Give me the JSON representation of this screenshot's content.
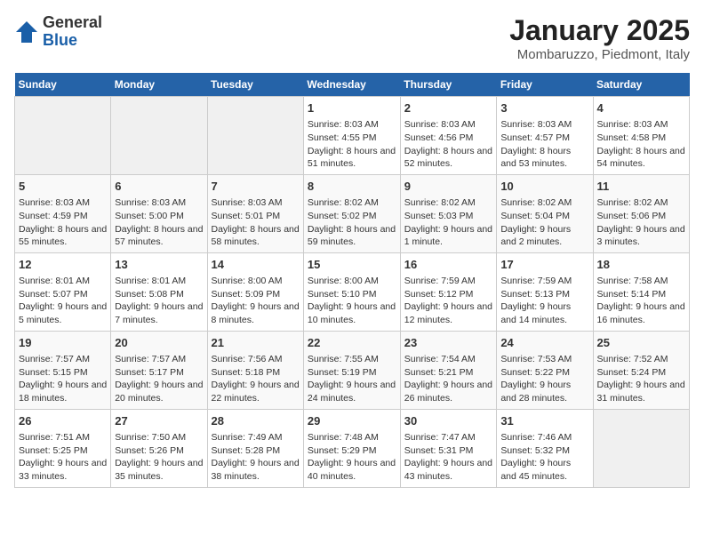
{
  "logo": {
    "general": "General",
    "blue": "Blue"
  },
  "title": "January 2025",
  "subtitle": "Mombaruzzo, Piedmont, Italy",
  "days_of_week": [
    "Sunday",
    "Monday",
    "Tuesday",
    "Wednesday",
    "Thursday",
    "Friday",
    "Saturday"
  ],
  "weeks": [
    [
      {
        "day": "",
        "info": ""
      },
      {
        "day": "",
        "info": ""
      },
      {
        "day": "",
        "info": ""
      },
      {
        "day": "1",
        "info": "Sunrise: 8:03 AM\nSunset: 4:55 PM\nDaylight: 8 hours and 51 minutes."
      },
      {
        "day": "2",
        "info": "Sunrise: 8:03 AM\nSunset: 4:56 PM\nDaylight: 8 hours and 52 minutes."
      },
      {
        "day": "3",
        "info": "Sunrise: 8:03 AM\nSunset: 4:57 PM\nDaylight: 8 hours and 53 minutes."
      },
      {
        "day": "4",
        "info": "Sunrise: 8:03 AM\nSunset: 4:58 PM\nDaylight: 8 hours and 54 minutes."
      }
    ],
    [
      {
        "day": "5",
        "info": "Sunrise: 8:03 AM\nSunset: 4:59 PM\nDaylight: 8 hours and 55 minutes."
      },
      {
        "day": "6",
        "info": "Sunrise: 8:03 AM\nSunset: 5:00 PM\nDaylight: 8 hours and 57 minutes."
      },
      {
        "day": "7",
        "info": "Sunrise: 8:03 AM\nSunset: 5:01 PM\nDaylight: 8 hours and 58 minutes."
      },
      {
        "day": "8",
        "info": "Sunrise: 8:02 AM\nSunset: 5:02 PM\nDaylight: 8 hours and 59 minutes."
      },
      {
        "day": "9",
        "info": "Sunrise: 8:02 AM\nSunset: 5:03 PM\nDaylight: 9 hours and 1 minute."
      },
      {
        "day": "10",
        "info": "Sunrise: 8:02 AM\nSunset: 5:04 PM\nDaylight: 9 hours and 2 minutes."
      },
      {
        "day": "11",
        "info": "Sunrise: 8:02 AM\nSunset: 5:06 PM\nDaylight: 9 hours and 3 minutes."
      }
    ],
    [
      {
        "day": "12",
        "info": "Sunrise: 8:01 AM\nSunset: 5:07 PM\nDaylight: 9 hours and 5 minutes."
      },
      {
        "day": "13",
        "info": "Sunrise: 8:01 AM\nSunset: 5:08 PM\nDaylight: 9 hours and 7 minutes."
      },
      {
        "day": "14",
        "info": "Sunrise: 8:00 AM\nSunset: 5:09 PM\nDaylight: 9 hours and 8 minutes."
      },
      {
        "day": "15",
        "info": "Sunrise: 8:00 AM\nSunset: 5:10 PM\nDaylight: 9 hours and 10 minutes."
      },
      {
        "day": "16",
        "info": "Sunrise: 7:59 AM\nSunset: 5:12 PM\nDaylight: 9 hours and 12 minutes."
      },
      {
        "day": "17",
        "info": "Sunrise: 7:59 AM\nSunset: 5:13 PM\nDaylight: 9 hours and 14 minutes."
      },
      {
        "day": "18",
        "info": "Sunrise: 7:58 AM\nSunset: 5:14 PM\nDaylight: 9 hours and 16 minutes."
      }
    ],
    [
      {
        "day": "19",
        "info": "Sunrise: 7:57 AM\nSunset: 5:15 PM\nDaylight: 9 hours and 18 minutes."
      },
      {
        "day": "20",
        "info": "Sunrise: 7:57 AM\nSunset: 5:17 PM\nDaylight: 9 hours and 20 minutes."
      },
      {
        "day": "21",
        "info": "Sunrise: 7:56 AM\nSunset: 5:18 PM\nDaylight: 9 hours and 22 minutes."
      },
      {
        "day": "22",
        "info": "Sunrise: 7:55 AM\nSunset: 5:19 PM\nDaylight: 9 hours and 24 minutes."
      },
      {
        "day": "23",
        "info": "Sunrise: 7:54 AM\nSunset: 5:21 PM\nDaylight: 9 hours and 26 minutes."
      },
      {
        "day": "24",
        "info": "Sunrise: 7:53 AM\nSunset: 5:22 PM\nDaylight: 9 hours and 28 minutes."
      },
      {
        "day": "25",
        "info": "Sunrise: 7:52 AM\nSunset: 5:24 PM\nDaylight: 9 hours and 31 minutes."
      }
    ],
    [
      {
        "day": "26",
        "info": "Sunrise: 7:51 AM\nSunset: 5:25 PM\nDaylight: 9 hours and 33 minutes."
      },
      {
        "day": "27",
        "info": "Sunrise: 7:50 AM\nSunset: 5:26 PM\nDaylight: 9 hours and 35 minutes."
      },
      {
        "day": "28",
        "info": "Sunrise: 7:49 AM\nSunset: 5:28 PM\nDaylight: 9 hours and 38 minutes."
      },
      {
        "day": "29",
        "info": "Sunrise: 7:48 AM\nSunset: 5:29 PM\nDaylight: 9 hours and 40 minutes."
      },
      {
        "day": "30",
        "info": "Sunrise: 7:47 AM\nSunset: 5:31 PM\nDaylight: 9 hours and 43 minutes."
      },
      {
        "day": "31",
        "info": "Sunrise: 7:46 AM\nSunset: 5:32 PM\nDaylight: 9 hours and 45 minutes."
      },
      {
        "day": "",
        "info": ""
      }
    ]
  ]
}
